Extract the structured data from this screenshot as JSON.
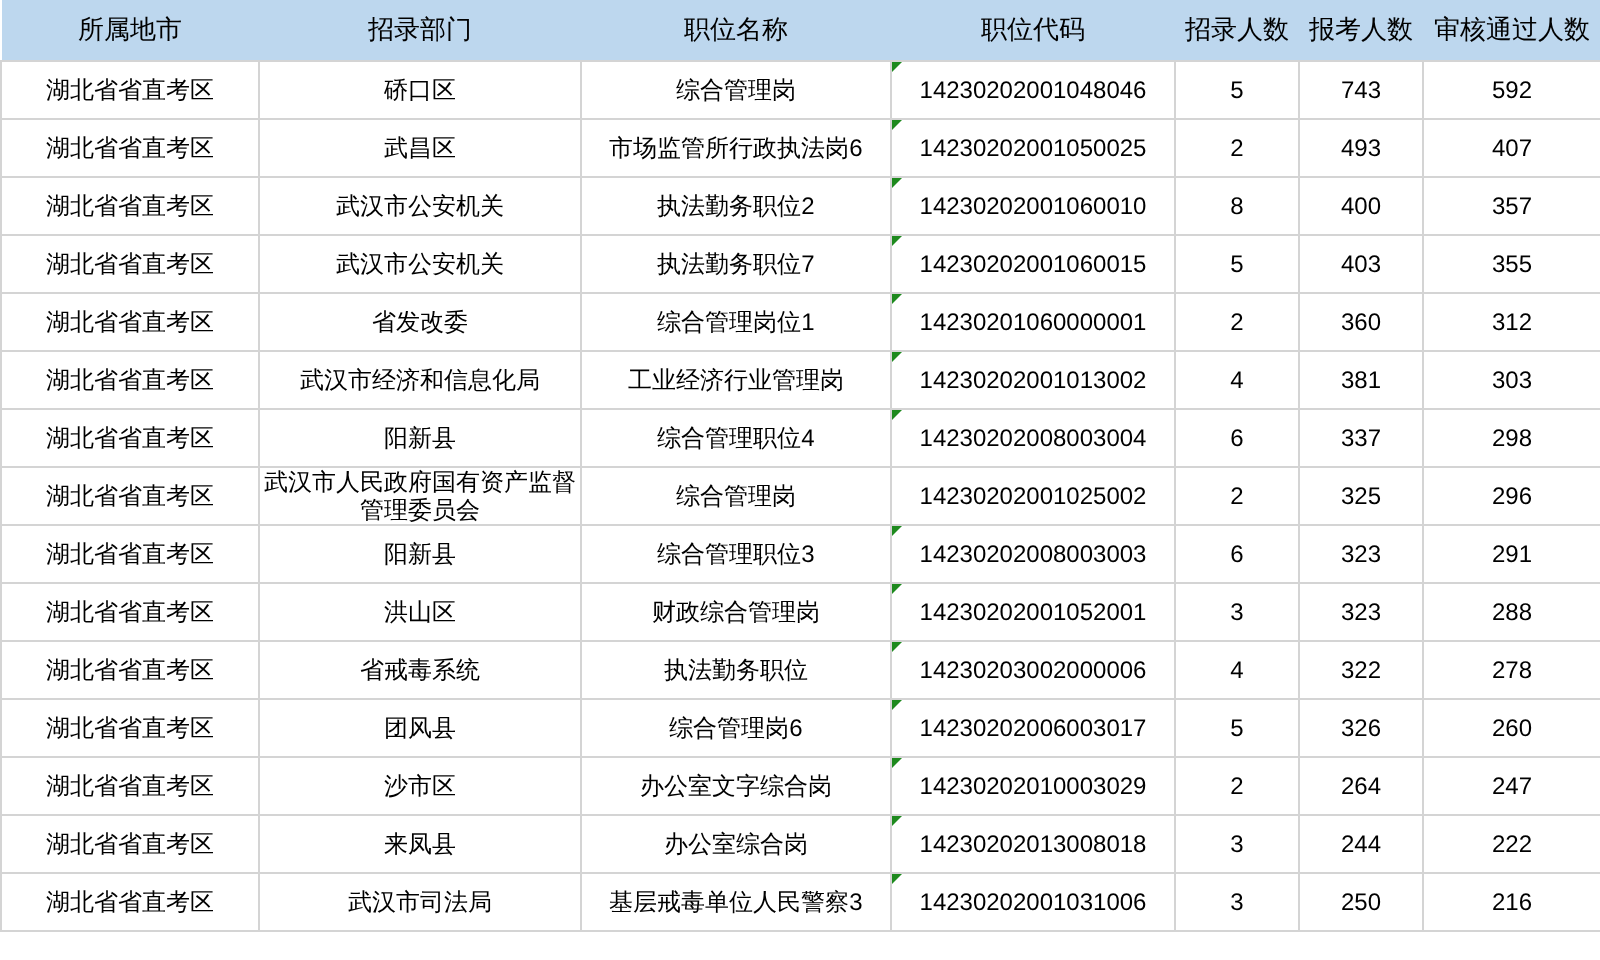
{
  "table": {
    "columns": [
      "所属地市",
      "招录部门",
      "职位名称",
      "职位代码",
      "招录人数",
      "报考人数",
      "审核通过人数"
    ],
    "rows": [
      {
        "cells": [
          "湖北省省直考区",
          "硚口区",
          "综合管理岗",
          "14230202001048046",
          "5",
          "743",
          "592"
        ],
        "flagged": true
      },
      {
        "cells": [
          "湖北省省直考区",
          "武昌区",
          "市场监管所行政执法岗6",
          "14230202001050025",
          "2",
          "493",
          "407"
        ],
        "flagged": true
      },
      {
        "cells": [
          "湖北省省直考区",
          "武汉市公安机关",
          "执法勤务职位2",
          "14230202001060010",
          "8",
          "400",
          "357"
        ],
        "flagged": true
      },
      {
        "cells": [
          "湖北省省直考区",
          "武汉市公安机关",
          "执法勤务职位7",
          "14230202001060015",
          "5",
          "403",
          "355"
        ],
        "flagged": true
      },
      {
        "cells": [
          "湖北省省直考区",
          "省发改委",
          "综合管理岗位1",
          "14230201060000001",
          "2",
          "360",
          "312"
        ],
        "flagged": true
      },
      {
        "cells": [
          "湖北省省直考区",
          "武汉市经济和信息化局",
          "工业经济行业管理岗",
          "14230202001013002",
          "4",
          "381",
          "303"
        ],
        "flagged": true
      },
      {
        "cells": [
          "湖北省省直考区",
          "阳新县",
          "综合管理职位4",
          "14230202008003004",
          "6",
          "337",
          "298"
        ],
        "flagged": true
      },
      {
        "cells": [
          "湖北省省直考区",
          "武汉市人民政府国有资产监督管理委员会",
          "综合管理岗",
          "14230202001025002",
          "2",
          "325",
          "296"
        ],
        "flagged": false
      },
      {
        "cells": [
          "湖北省省直考区",
          "阳新县",
          "综合管理职位3",
          "14230202008003003",
          "6",
          "323",
          "291"
        ],
        "flagged": true
      },
      {
        "cells": [
          "湖北省省直考区",
          "洪山区",
          "财政综合管理岗",
          "14230202001052001",
          "3",
          "323",
          "288"
        ],
        "flagged": true
      },
      {
        "cells": [
          "湖北省省直考区",
          "省戒毒系统",
          "执法勤务职位",
          "14230203002000006",
          "4",
          "322",
          "278"
        ],
        "flagged": true
      },
      {
        "cells": [
          "湖北省省直考区",
          "团风县",
          "综合管理岗6",
          "14230202006003017",
          "5",
          "326",
          "260"
        ],
        "flagged": true
      },
      {
        "cells": [
          "湖北省省直考区",
          "沙市区",
          "办公室文字综合岗",
          "14230202010003029",
          "2",
          "264",
          "247"
        ],
        "flagged": true
      },
      {
        "cells": [
          "湖北省省直考区",
          "来凤县",
          "办公室综合岗",
          "14230202013008018",
          "3",
          "244",
          "222"
        ],
        "flagged": true
      },
      {
        "cells": [
          "湖北省省直考区",
          "武汉市司法局",
          "基层戒毒单位人民警察3",
          "14230202001031006",
          "3",
          "250",
          "216"
        ],
        "flagged": true
      }
    ]
  }
}
